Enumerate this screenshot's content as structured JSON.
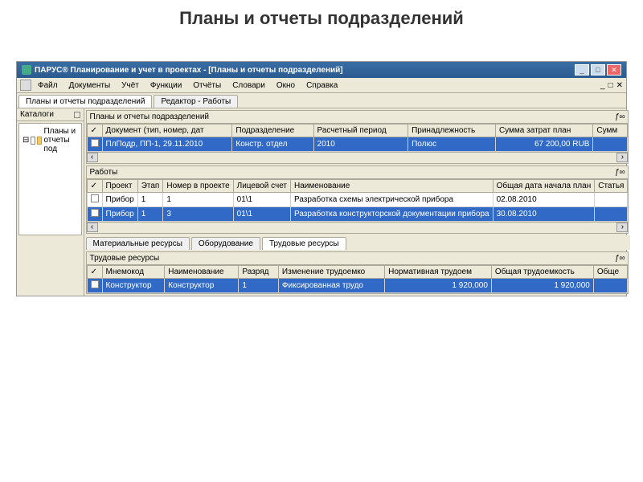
{
  "page_title": "Планы и отчеты подразделений",
  "window_title": "ПАРУС® Планирование и учет в проектах - [Планы и отчеты подразделений]",
  "menu": [
    "Файл",
    "Документы",
    "Учёт",
    "Функции",
    "Отчёты",
    "Словари",
    "Окно",
    "Справка"
  ],
  "main_tabs": [
    "Планы и отчеты подразделений",
    "Редактор - Работы"
  ],
  "sidebar_title": "Каталоги",
  "tree_root": "Планы и отчеты под",
  "panel1_title": "Планы и отчеты подразделений",
  "fx": "ƒ∞",
  "grid1_cols": [
    "✓",
    "Документ (тип, номер, дат",
    "Подразделение",
    "Расчетный период",
    "Принадлежность",
    "Сумма затрат план",
    "Сумм"
  ],
  "grid1_r1": [
    "ПлПодр, ПП-1, 29.11.2010",
    "Констр. отдел",
    "2010",
    "Полюс",
    "67 200,00 RUB",
    ""
  ],
  "panel2_title": "Работы",
  "grid2_cols": [
    "✓",
    "Проект",
    "Этап",
    "Номер в проекте",
    "Лицевой счет",
    "Наименование",
    "Общая дата начала план",
    "Статья"
  ],
  "grid2_r1": [
    "Прибор",
    "1",
    "1",
    "01\\1",
    "Разработка схемы электрической прибора",
    "02.08.2010",
    ""
  ],
  "grid2_r2": [
    "Прибор",
    "1",
    "3",
    "01\\1",
    "Разработка конструкторской документации прибора",
    "30.08.2010",
    ""
  ],
  "sub_tabs": [
    "Материальные ресурсы",
    "Оборудование",
    "Трудовые ресурсы"
  ],
  "panel3_title": "Трудовые ресурсы",
  "grid3_cols": [
    "✓",
    "Мнемокод",
    "Наименование",
    "Разряд",
    "Изменение трудоемко",
    "Нормативная трудоем",
    "Общая трудоемкость",
    "Обще"
  ],
  "grid3_r1": [
    "Конструктор",
    "Конструктор",
    "1",
    "Фиксированная трудо",
    "1 920,000",
    "1 920,000",
    ""
  ]
}
